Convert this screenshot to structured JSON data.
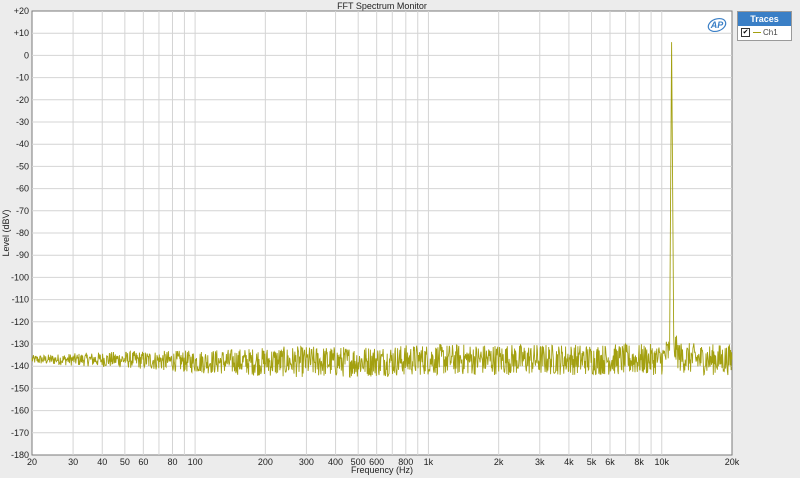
{
  "chart_data": {
    "type": "line",
    "title": "FFT Spectrum Monitor",
    "xlabel": "Frequency (Hz)",
    "ylabel": "Level (dBV)",
    "xscale": "log",
    "xlim": [
      20,
      20000
    ],
    "ylim": [
      -180,
      20
    ],
    "x_tick_labels": [
      {
        "v": 20,
        "label": "20"
      },
      {
        "v": 30,
        "label": "30"
      },
      {
        "v": 40,
        "label": "40"
      },
      {
        "v": 50,
        "label": "50"
      },
      {
        "v": 60,
        "label": "60"
      },
      {
        "v": 80,
        "label": "80"
      },
      {
        "v": 100,
        "label": "100"
      },
      {
        "v": 200,
        "label": "200"
      },
      {
        "v": 300,
        "label": "300"
      },
      {
        "v": 400,
        "label": "400"
      },
      {
        "v": 500,
        "label": "500"
      },
      {
        "v": 600,
        "label": "600"
      },
      {
        "v": 800,
        "label": "800"
      },
      {
        "v": 1000,
        "label": "1k"
      },
      {
        "v": 2000,
        "label": "2k"
      },
      {
        "v": 3000,
        "label": "3k"
      },
      {
        "v": 4000,
        "label": "4k"
      },
      {
        "v": 5000,
        "label": "5k"
      },
      {
        "v": 6000,
        "label": "6k"
      },
      {
        "v": 8000,
        "label": "8k"
      },
      {
        "v": 10000,
        "label": "10k"
      },
      {
        "v": 20000,
        "label": "20k"
      }
    ],
    "y_tick_labels": [
      "+20",
      "+10",
      "0",
      "-10",
      "-20",
      "-30",
      "-40",
      "-50",
      "-60",
      "-70",
      "-80",
      "-90",
      "-100",
      "-110",
      "-120",
      "-130",
      "-140",
      "-150",
      "-160",
      "-170",
      "-180"
    ],
    "grid": true,
    "series": [
      {
        "name": "Ch1",
        "color": "#a3a010",
        "x": [
          20,
          30,
          50,
          100,
          200,
          500,
          1000,
          2000,
          5000,
          10000,
          10800,
          11025,
          11250,
          12000,
          15000,
          20000
        ],
        "y": [
          -137,
          -137,
          -137,
          -138,
          -138,
          -138,
          -137,
          -137,
          -137,
          -137,
          -133,
          6,
          -131,
          -136,
          -137,
          -137
        ]
      }
    ]
  },
  "legend": {
    "header": "Traces",
    "position": "top-right",
    "items": [
      {
        "label": "Ch1",
        "checked": true
      }
    ]
  },
  "logo": {
    "text": "AP"
  },
  "colors": {
    "trace": "#a3a010",
    "grid": "#d4d4d4",
    "legend_header": "#3a7fc6"
  }
}
